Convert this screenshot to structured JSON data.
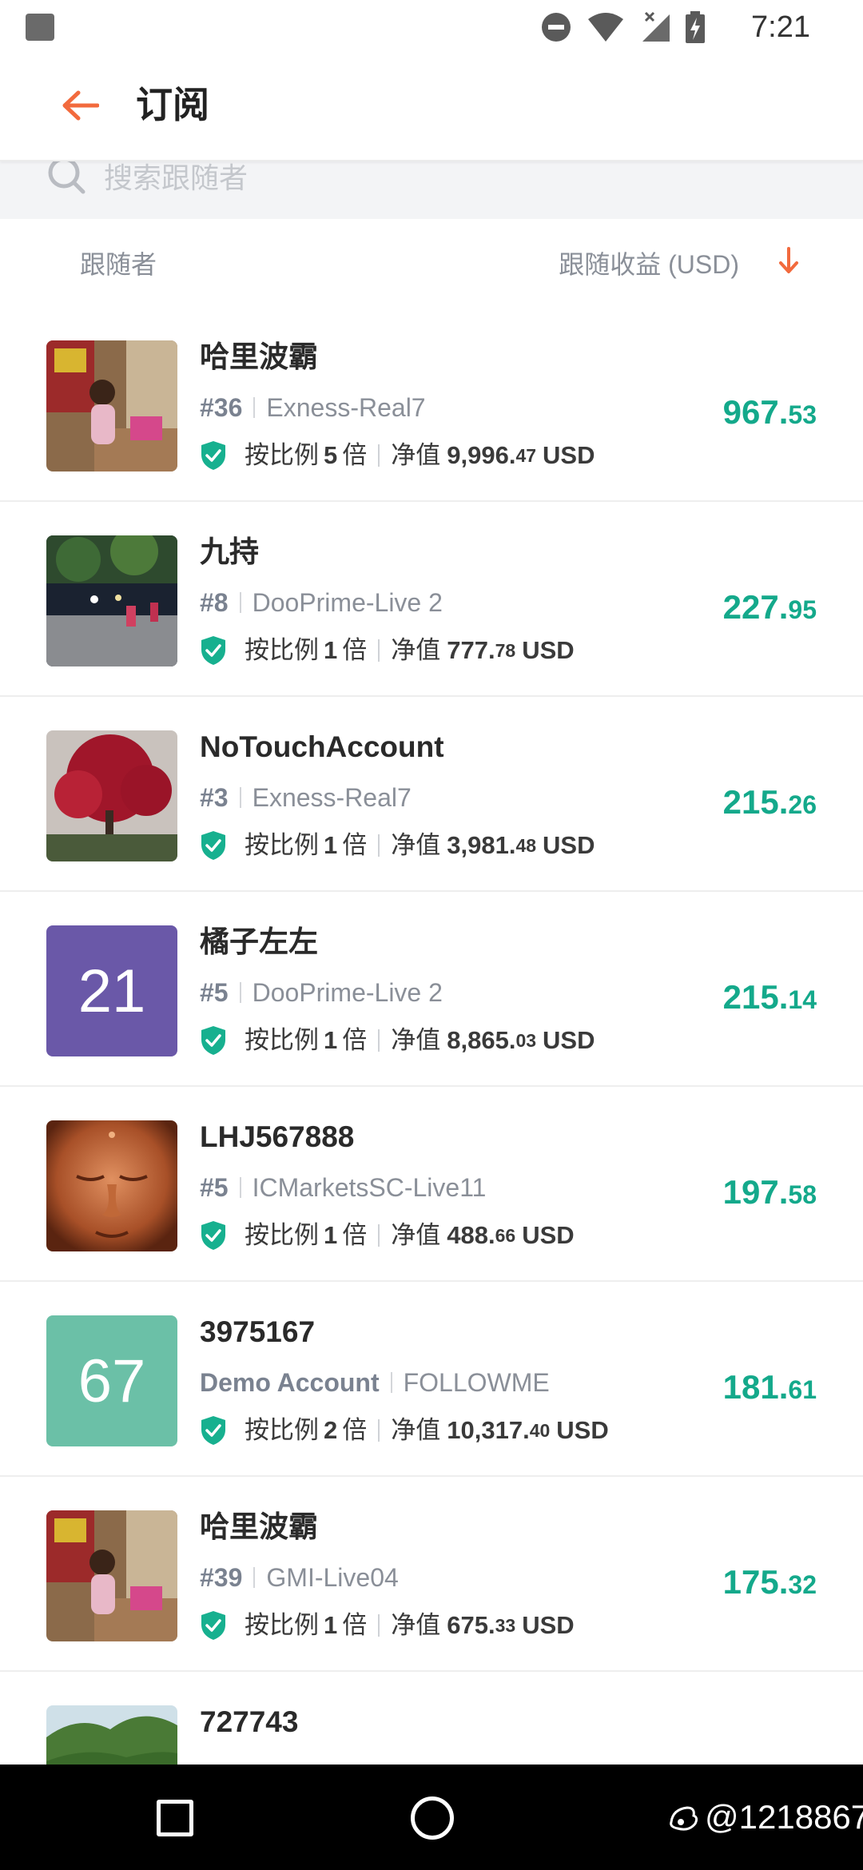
{
  "status_bar": {
    "time": "7:21",
    "icons": [
      "notification-icon",
      "dnd-icon",
      "wifi-icon",
      "signal-icon",
      "battery-charging-icon"
    ]
  },
  "header": {
    "back_icon": "arrow-left-icon",
    "title": "订阅"
  },
  "search": {
    "placeholder": "搜索跟随者"
  },
  "columns": {
    "left": "跟随者",
    "right": "跟随收益 (USD)",
    "sort_icon": "arrow-down-icon"
  },
  "colors": {
    "accent": "#f26a3d",
    "profit": "#14a98b",
    "shield": "#17b08f"
  },
  "followers": [
    {
      "name": "哈里波霸",
      "rank": "#36",
      "server": "Exness-Real7",
      "ratio_label": "按比例",
      "ratio": "5",
      "ratio_unit": "倍",
      "equity_label": "净值",
      "equity_int": "9,996.",
      "equity_dec": "47",
      "currency": "USD",
      "profit_int": "967.",
      "profit_dec": "53",
      "avatar": {
        "type": "photo",
        "subject": "child-indoors"
      }
    },
    {
      "name": "九持",
      "rank": "#8",
      "server": "DooPrime-Live 2",
      "ratio_label": "按比例",
      "ratio": "1",
      "ratio_unit": "倍",
      "equity_label": "净值",
      "equity_int": "777.",
      "equity_dec": "78",
      "currency": "USD",
      "profit_int": "227.",
      "profit_dec": "95",
      "avatar": {
        "type": "photo",
        "subject": "night-street"
      }
    },
    {
      "name": "NoTouchAccount",
      "rank": "#3",
      "server": "Exness-Real7",
      "ratio_label": "按比例",
      "ratio": "1",
      "ratio_unit": "倍",
      "equity_label": "净值",
      "equity_int": "3,981.",
      "equity_dec": "48",
      "currency": "USD",
      "profit_int": "215.",
      "profit_dec": "26",
      "avatar": {
        "type": "photo",
        "subject": "red-maple-tree"
      }
    },
    {
      "name": "橘子左左",
      "rank": "#5",
      "server": "DooPrime-Live 2",
      "ratio_label": "按比例",
      "ratio": "1",
      "ratio_unit": "倍",
      "equity_label": "净值",
      "equity_int": "8,865.",
      "equity_dec": "03",
      "currency": "USD",
      "profit_int": "215.",
      "profit_dec": "14",
      "avatar": {
        "type": "number",
        "text": "21",
        "color": "#6a58a8"
      }
    },
    {
      "name": "LHJ567888",
      "rank": "#5",
      "server": "ICMarketsSC-Live11",
      "ratio_label": "按比例",
      "ratio": "1",
      "ratio_unit": "倍",
      "equity_label": "净值",
      "equity_int": "488.",
      "equity_dec": "66",
      "currency": "USD",
      "profit_int": "197.",
      "profit_dec": "58",
      "avatar": {
        "type": "photo",
        "subject": "buddha-face"
      }
    },
    {
      "name": "3975167",
      "rank": "Demo Account",
      "server": "FOLLOWME",
      "ratio_label": "按比例",
      "ratio": "2",
      "ratio_unit": "倍",
      "equity_label": "净值",
      "equity_int": "10,317.",
      "equity_dec": "40",
      "currency": "USD",
      "profit_int": "181.",
      "profit_dec": "61",
      "avatar": {
        "type": "number",
        "text": "67",
        "color": "#6bc0a7"
      }
    },
    {
      "name": "哈里波霸",
      "rank": "#39",
      "server": "GMI-Live04",
      "ratio_label": "按比例",
      "ratio": "1",
      "ratio_unit": "倍",
      "equity_label": "净值",
      "equity_int": "675.",
      "equity_dec": "33",
      "currency": "USD",
      "profit_int": "175.",
      "profit_dec": "32",
      "avatar": {
        "type": "photo",
        "subject": "child-indoors"
      }
    },
    {
      "name": "727743",
      "avatar": {
        "type": "photo",
        "subject": "green-hills"
      }
    }
  ],
  "nav_bar": {
    "icons": [
      "recent-apps-icon",
      "home-icon"
    ],
    "watermark": "@1218867"
  }
}
